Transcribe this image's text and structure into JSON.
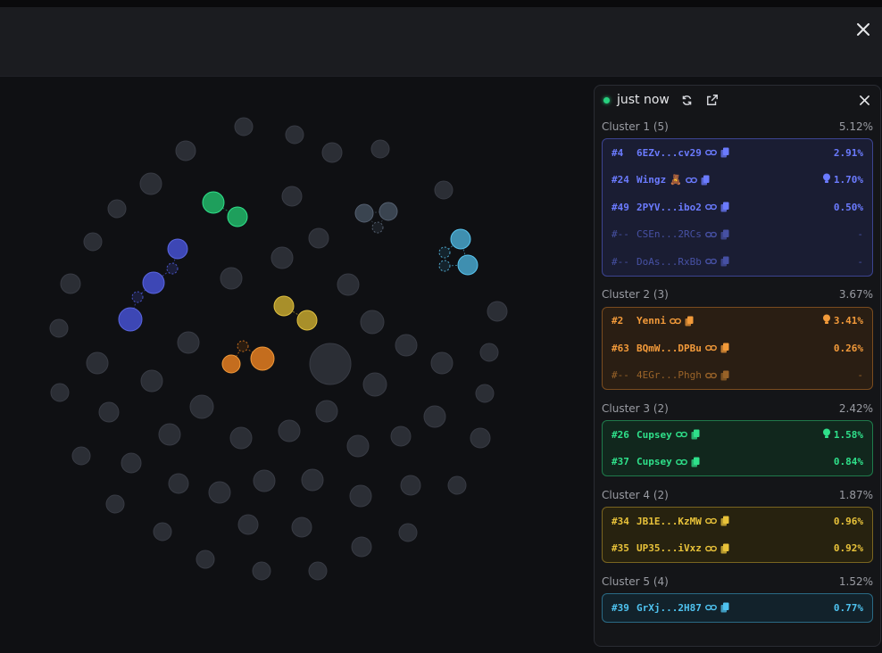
{
  "panel": {
    "time": "just now",
    "clusters": [
      {
        "title": "Cluster 1 (5)",
        "pct": "5.12%",
        "color": "#6b7bff",
        "bg": "#1a1d33",
        "border": "#3c4490",
        "rows": [
          {
            "rank": "#4",
            "name": "6EZv...cv29",
            "pct": "2.91%",
            "badge": "",
            "tip": false,
            "dim": false
          },
          {
            "rank": "#24",
            "name": "Wingz",
            "pct": "1.70%",
            "badge": "🧸",
            "tip": true,
            "dim": false
          },
          {
            "rank": "#49",
            "name": "2PYV...ibo2",
            "pct": "0.50%",
            "badge": "",
            "tip": false,
            "dim": false
          },
          {
            "rank": "#--",
            "name": "CSEn...2RCs",
            "pct": "-",
            "badge": "",
            "tip": false,
            "dim": true
          },
          {
            "rank": "#--",
            "name": "DoAs...RxBb",
            "pct": "-",
            "badge": "",
            "tip": false,
            "dim": true
          }
        ]
      },
      {
        "title": "Cluster 2 (3)",
        "pct": "3.67%",
        "color": "#f29a3a",
        "bg": "#2a1e13",
        "border": "#7a4c1f",
        "rows": [
          {
            "rank": "#2",
            "name": "Yenni",
            "pct": "3.41%",
            "badge": "",
            "tip": true,
            "dim": false
          },
          {
            "rank": "#63",
            "name": "BQmW...DPBu",
            "pct": "0.26%",
            "badge": "",
            "tip": false,
            "dim": false
          },
          {
            "rank": "#--",
            "name": "4EGr...Phgh",
            "pct": "-",
            "badge": "",
            "tip": false,
            "dim": true
          }
        ]
      },
      {
        "title": "Cluster 3 (2)",
        "pct": "2.42%",
        "color": "#2fe08a",
        "bg": "#11271d",
        "border": "#1f7a4b",
        "rows": [
          {
            "rank": "#26",
            "name": "Cupsey",
            "pct": "1.58%",
            "badge": "",
            "tip": true,
            "dim": false
          },
          {
            "rank": "#37",
            "name": "Cupsey",
            "pct": "0.84%",
            "badge": "",
            "tip": false,
            "dim": false
          }
        ]
      },
      {
        "title": "Cluster 4 (2)",
        "pct": "1.87%",
        "color": "#e8c23a",
        "bg": "#27220f",
        "border": "#7a6520",
        "rows": [
          {
            "rank": "#34",
            "name": "JB1E...KzMW",
            "pct": "0.96%",
            "badge": "",
            "tip": false,
            "dim": false
          },
          {
            "rank": "#35",
            "name": "UP35...iVxz",
            "pct": "0.92%",
            "badge": "",
            "tip": false,
            "dim": false
          }
        ]
      },
      {
        "title": "Cluster 5 (4)",
        "pct": "1.52%",
        "color": "#4fc3f0",
        "bg": "#12222b",
        "border": "#2a6a85",
        "rows": [
          {
            "rank": "#39",
            "name": "GrXj...2H87",
            "pct": "0.77%",
            "badge": "",
            "tip": false,
            "dim": false
          }
        ]
      }
    ]
  },
  "graph": {
    "colors": {
      "node": "#2b2e35",
      "nodeStroke": "#383b44",
      "blue": "#3d47b5",
      "green": "#1e9f5c",
      "yellow": "#a88f2a",
      "orange": "#c46d1e",
      "cyan": "#3f8fb0",
      "slate": "#3a4450"
    }
  }
}
